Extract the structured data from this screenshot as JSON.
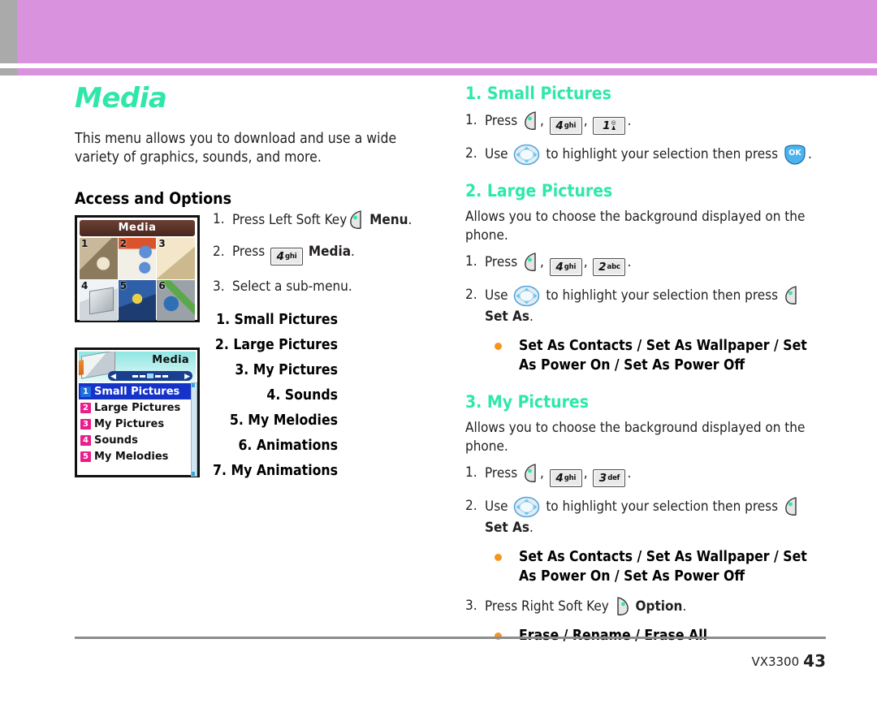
{
  "header": {
    "band_color": "#d992de",
    "tab_color": "#aaaaaa"
  },
  "chapter": {
    "title": "Media",
    "title_color": "#2fe8a8",
    "intro": "This menu allows you to download and use a wide variety of graphics, sounds, and more.",
    "subhead": "Access and Options"
  },
  "access_steps": [
    {
      "num": "1.",
      "pre": "Press Left Soft Key",
      "icon": "left-soft-key",
      "post": "Menu",
      "tail": "."
    },
    {
      "num": "2.",
      "pre": "Press",
      "icon": "key-4-ghi",
      "key_digit": "4",
      "key_sup": "ghi",
      "post": "Media",
      "tail": "."
    },
    {
      "num": "3.",
      "pre": "Select a sub-menu.",
      "icon": "",
      "post": "",
      "tail": ""
    }
  ],
  "submenu_items": [
    "1. Small Pictures",
    "2. Large Pictures",
    "3. My Pictures",
    "4. Sounds",
    "5. My Melodies",
    "6. Animations",
    "7. My Animations"
  ],
  "phone_grid": {
    "title": "Media",
    "cells": [
      {
        "num": "1",
        "selected": false
      },
      {
        "num": "2",
        "selected": false
      },
      {
        "num": "3",
        "selected": false
      },
      {
        "num": "4",
        "selected": true
      },
      {
        "num": "5",
        "selected": false
      },
      {
        "num": "6",
        "selected": false
      }
    ]
  },
  "phone_list": {
    "title": "Media",
    "rows": [
      {
        "badge": "1",
        "label": "Small Pictures",
        "selected": true
      },
      {
        "badge": "2",
        "label": "Large Pictures",
        "selected": false
      },
      {
        "badge": "3",
        "label": "My Pictures",
        "selected": false
      },
      {
        "badge": "4",
        "label": "Sounds",
        "selected": false
      },
      {
        "badge": "5",
        "label": "My Melodies",
        "selected": false
      }
    ]
  },
  "sections": [
    {
      "heading": "1. Small Pictures",
      "desc": "",
      "steps": [
        {
          "num": "1.",
          "verb": "Press",
          "keys": [
            {
              "type": "softkey-left"
            },
            {
              "type": "numkey",
              "digit": "4",
              "sup": "ghi"
            },
            {
              "type": "numkey",
              "digit": "1",
              "sup": "voicemail"
            }
          ],
          "tail": "."
        },
        {
          "num": "2.",
          "verb": "Use",
          "nav": true,
          "mid": "to highlight your selection then press",
          "endkey": "ok",
          "tail": "."
        }
      ],
      "bullets": []
    },
    {
      "heading": "2. Large Pictures",
      "desc": "Allows you to choose the background displayed on the phone.",
      "steps": [
        {
          "num": "1.",
          "verb": "Press",
          "keys": [
            {
              "type": "softkey-left"
            },
            {
              "type": "numkey",
              "digit": "4",
              "sup": "ghi"
            },
            {
              "type": "numkey",
              "digit": "2",
              "sup": "abc"
            }
          ],
          "tail": "."
        },
        {
          "num": "2.",
          "verb": "Use",
          "nav": true,
          "mid": "to highlight your selection then press",
          "endkey": "softkey-left",
          "endlabel": "Set As",
          "tail": "."
        }
      ],
      "bullets": [
        "Set As Contacts / Set As Wallpaper / Set As Power On / Set As Power Off"
      ]
    },
    {
      "heading": "3. My Pictures",
      "desc": "Allows you to choose the background displayed on the phone.",
      "steps": [
        {
          "num": "1.",
          "verb": "Press",
          "keys": [
            {
              "type": "softkey-left"
            },
            {
              "type": "numkey",
              "digit": "4",
              "sup": "ghi"
            },
            {
              "type": "numkey",
              "digit": "3",
              "sup": "def"
            }
          ],
          "tail": "."
        },
        {
          "num": "2.",
          "verb": "Use",
          "nav": true,
          "mid": "to highlight your selection then press",
          "endkey": "softkey-left",
          "endlabel": "Set As",
          "tail": "."
        },
        {
          "num": "3.",
          "verb": "Press Right  Soft Key",
          "endkey": "softkey-right",
          "endlabel": "Option",
          "tail": "."
        }
      ],
      "bullets": [
        "Set As Contacts / Set As Wallpaper / Set As Power On / Set As Power Off",
        "Erase / Rename / Erase All"
      ]
    }
  ],
  "footer": {
    "model": "VX3300",
    "page": "43"
  }
}
